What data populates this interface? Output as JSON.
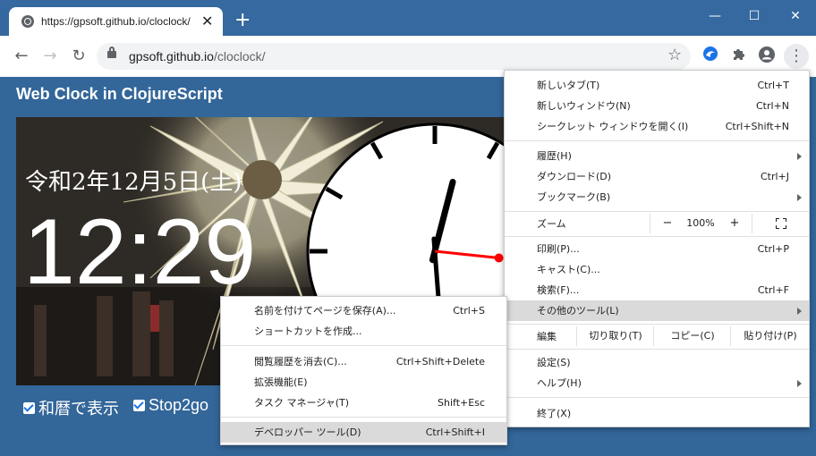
{
  "tab": {
    "title": "https://gpsoft.github.io/cloclock/",
    "close": "✕",
    "new": "+"
  },
  "window_controls": {
    "minimize": "—",
    "maximize": "☐",
    "close": "✕"
  },
  "omnibox": {
    "host": "gpsoft.github.io",
    "path": "/cloclock/"
  },
  "page": {
    "title": "Web Clock in ClojureScript",
    "date": "令和2年12月5日(土)",
    "time": "12:29",
    "checkboxes": [
      {
        "label": "和暦で表示",
        "checked": true
      },
      {
        "label": "Stop2go",
        "checked": true
      }
    ]
  },
  "clock": {
    "hour": 12,
    "minute": 29,
    "second": 16
  },
  "main_menu": {
    "items": [
      {
        "label": "新しいタブ(T)",
        "shortcut": "Ctrl+T"
      },
      {
        "label": "新しいウィンドウ(N)",
        "shortcut": "Ctrl+N"
      },
      {
        "label": "シークレット ウィンドウを開く(I)",
        "shortcut": "Ctrl+Shift+N"
      },
      {
        "label": "履歴(H)",
        "shortcut": ""
      },
      {
        "label": "ダウンロード(D)",
        "shortcut": "Ctrl+J"
      },
      {
        "label": "ブックマーク(B)",
        "shortcut": ""
      },
      {
        "label": "印刷(P)...",
        "shortcut": "Ctrl+P"
      },
      {
        "label": "キャスト(C)...",
        "shortcut": ""
      },
      {
        "label": "検索(F)...",
        "shortcut": "Ctrl+F"
      },
      {
        "label": "その他のツール(L)",
        "shortcut": ""
      },
      {
        "label": "設定(S)",
        "shortcut": ""
      },
      {
        "label": "ヘルプ(H)",
        "shortcut": ""
      },
      {
        "label": "終了(X)",
        "shortcut": ""
      }
    ],
    "zoom": {
      "label": "ズーム",
      "minus": "−",
      "value": "100%",
      "plus": "+"
    },
    "edit": {
      "label": "編集",
      "cut": "切り取り(T)",
      "copy": "コピー(C)",
      "paste": "貼り付け(P)"
    }
  },
  "submenu": {
    "items": [
      {
        "label": "名前を付けてページを保存(A)...",
        "shortcut": "Ctrl+S"
      },
      {
        "label": "ショートカットを作成...",
        "shortcut": ""
      },
      {
        "label": "閲覧履歴を消去(C)...",
        "shortcut": "Ctrl+Shift+Delete"
      },
      {
        "label": "拡張機能(E)",
        "shortcut": ""
      },
      {
        "label": "タスク マネージャ(T)",
        "shortcut": "Shift+Esc"
      },
      {
        "label": "デベロッパー ツール(D)",
        "shortcut": "Ctrl+Shift+I"
      }
    ]
  },
  "colors": {
    "titlebar": "#35699f",
    "page_bg": "#336699",
    "highlight": "#dadada",
    "second_hand": "#ff0000"
  }
}
